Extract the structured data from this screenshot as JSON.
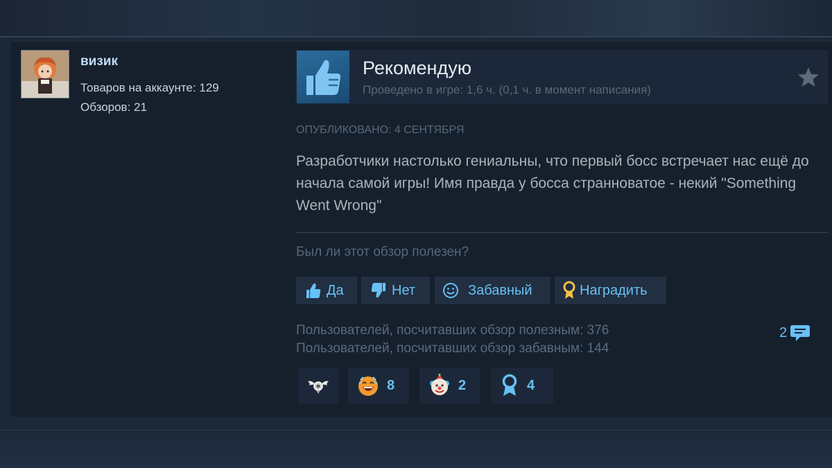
{
  "author": {
    "name": "визик",
    "games_owned": "Товаров на аккаунте: 129",
    "reviews": "Обзоров: 21",
    "avatar_icon": "anime-character-avatar"
  },
  "review": {
    "verdict": "Рекомендую",
    "verdict_icon": "thumbs-up-icon",
    "playtime": "Проведено в игре: 1,6 ч. (0,1 ч. в момент написания)",
    "posted": "ОПУБЛИКОВАНО: 4 СЕНТЯБРЯ",
    "text": "Разработчики настолько гениальны, что первый босс встречает нас ещё до начала самой игры! Имя правда у босса странноватое - некий \"Something Went Wrong\""
  },
  "feedback": {
    "question": "Был ли этот обзор полезен?",
    "yes_label": "Да",
    "no_label": "Нет",
    "funny_label": "Забавный",
    "award_label": "Наградить",
    "helpful_count_text": "Пользователей, посчитавших обзор полезным: 376",
    "funny_count_text": "Пользователей, посчитавших обзор забавным: 144",
    "comment_count": "2"
  },
  "reactions": [
    {
      "icon": "winged-award-icon",
      "count": ""
    },
    {
      "icon": "laughing-face-icon",
      "count": "8"
    },
    {
      "icon": "clown-face-icon",
      "count": "2"
    },
    {
      "icon": "medal-ribbon-icon",
      "count": "4"
    }
  ],
  "colors": {
    "background": "#1b2838",
    "card": "#16202d",
    "accent": "#67c1f5",
    "verdict_box": "#2b6d9c",
    "button_bg": "#212f41",
    "award_gold": "#f5c242"
  }
}
